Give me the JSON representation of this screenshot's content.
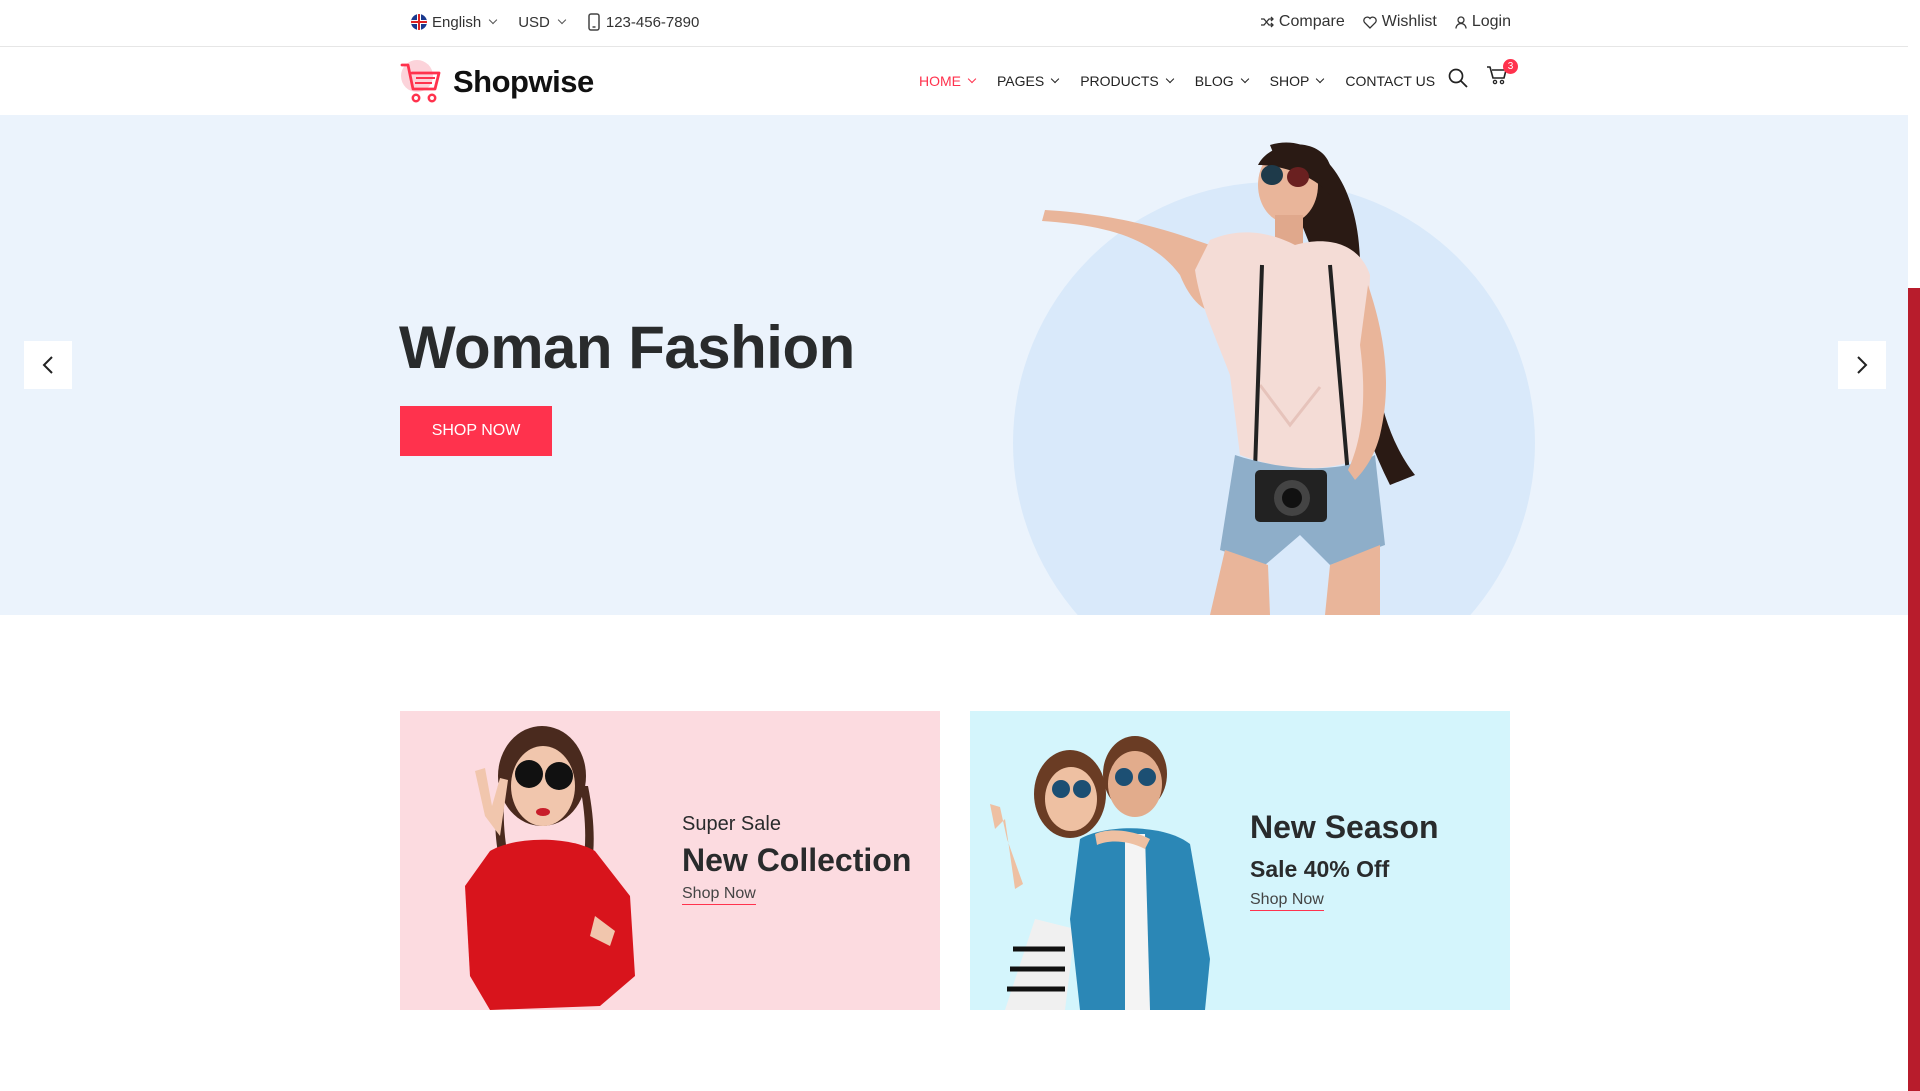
{
  "topbar": {
    "language": "English",
    "currency": "USD",
    "phone": "123-456-7890",
    "compare": "Compare",
    "wishlist": "Wishlist",
    "login": "Login"
  },
  "header": {
    "logo": "Shopwise",
    "nav": [
      {
        "label": "HOME",
        "active": true
      },
      {
        "label": "PAGES"
      },
      {
        "label": "PRODUCTS"
      },
      {
        "label": "BLOG"
      },
      {
        "label": "SHOP"
      },
      {
        "label": "CONTACT US"
      }
    ],
    "cart_count": "3"
  },
  "hero": {
    "title": "Woman Fashion",
    "button": "SHOP NOW"
  },
  "banners": [
    {
      "small": "Super Sale",
      "big": "New Collection",
      "link": "Shop Now"
    },
    {
      "big": "New Season",
      "mid": "Sale 40% Off",
      "link": "Shop Now"
    }
  ],
  "colors": {
    "accent": "#ff324d",
    "hero_bg": "#ebf3fc",
    "banner_pink": "#fcdbe0",
    "banner_cyan": "#d4f5fc"
  }
}
